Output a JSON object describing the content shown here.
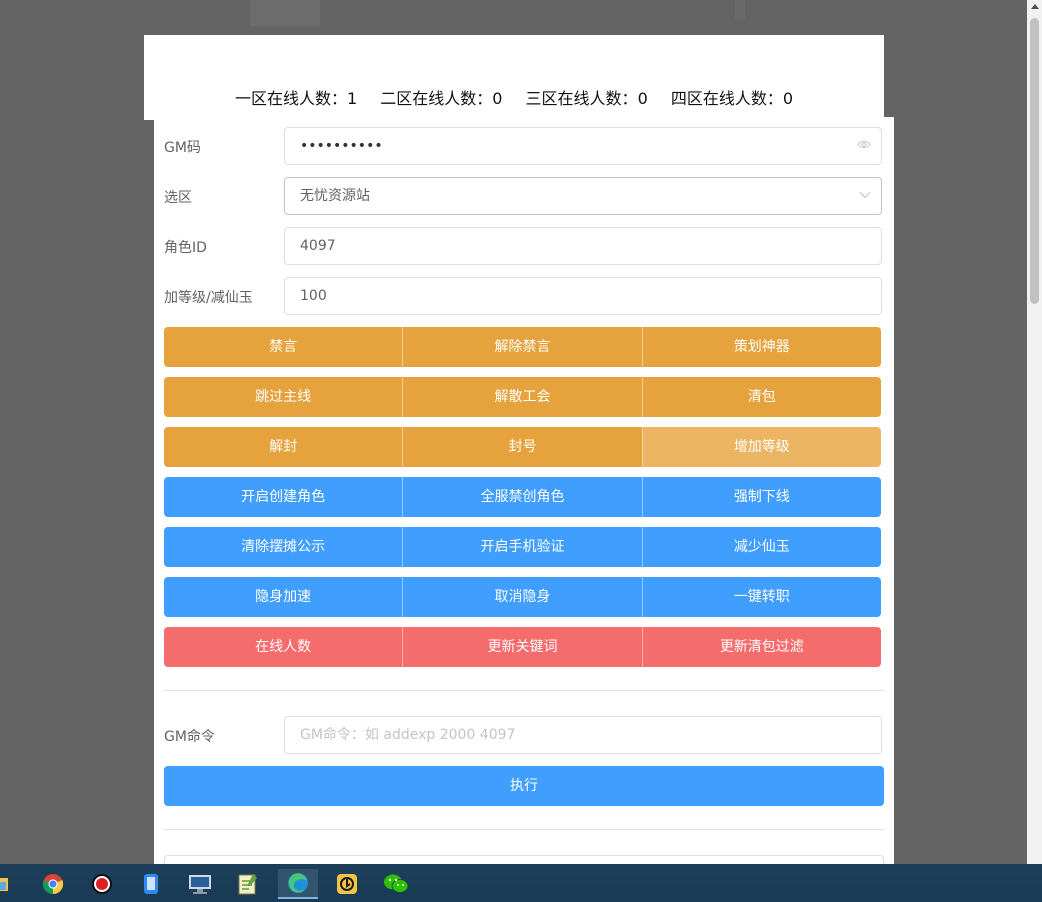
{
  "header": {
    "zones": [
      {
        "label": "一区在线人数：",
        "count": "1"
      },
      {
        "label": "二区在线人数：",
        "count": "0"
      },
      {
        "label": "三区在线人数：",
        "count": "0"
      },
      {
        "label": "四区在线人数：",
        "count": "0"
      }
    ]
  },
  "form": {
    "gm_code": {
      "label": "GM码",
      "masked_value": "••••••••••"
    },
    "zone_select": {
      "label": "选区",
      "value": "无忧资源站"
    },
    "role_id": {
      "label": "角色ID",
      "value": "4097"
    },
    "level": {
      "label": "加等级/减仙玉",
      "value": "100"
    }
  },
  "buttons": {
    "row1": [
      "禁言",
      "解除禁言",
      "策划神器"
    ],
    "row2": [
      "跳过主线",
      "解散工会",
      "清包"
    ],
    "row3": [
      "解封",
      "封号",
      "增加等级"
    ],
    "row4": [
      "开启创建角色",
      "全服禁创角色",
      "强制下线"
    ],
    "row5": [
      "清除摆摊公示",
      "开启手机验证",
      "减少仙玉"
    ],
    "row6": [
      "隐身加速",
      "取消隐身",
      "一键转职"
    ],
    "row7": [
      "在线人数",
      "更新关键词",
      "更新清包过滤"
    ]
  },
  "gm_command": {
    "label": "GM命令",
    "placeholder": "GM命令：如 addexp 2000 4097",
    "execute_label": "执行"
  },
  "taskbar": {
    "icons": [
      "folder-icon",
      "chrome-icon",
      "record-icon",
      "phone-icon",
      "computer-icon",
      "notepad-icon",
      "edge-icon",
      "remote-icon",
      "wechat-icon"
    ]
  },
  "colors": {
    "warning": "#e6a23c",
    "warning_hover": "#ebb563",
    "primary": "#409eff",
    "danger": "#f56c6c"
  }
}
